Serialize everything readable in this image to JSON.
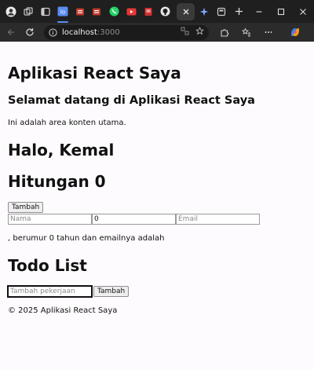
{
  "browser": {
    "address": {
      "host": "localhost",
      "port": ":3000"
    }
  },
  "page": {
    "title": "Aplikasi React Saya",
    "welcome": "Selamat datang di Aplikasi React Saya",
    "content_text": "Ini adalah area konten utama.",
    "greeting": "Halo, Kemal",
    "counter_label": "Hitungan 0",
    "add_button": "Tambah",
    "form": {
      "name_placeholder": "Nama",
      "age_value": "0",
      "email_placeholder": "Email"
    },
    "summary": ", berumur 0 tahun dan emailnya adalah",
    "todo_heading": "Todo List",
    "todo_placeholder": "Tambah pekerjaan",
    "todo_add_button": "Tambah",
    "footer": "© 2025 Aplikasi React Saya"
  },
  "colors": {
    "accent": "#5b8def",
    "chrome_dark": "#1f1f1f"
  }
}
